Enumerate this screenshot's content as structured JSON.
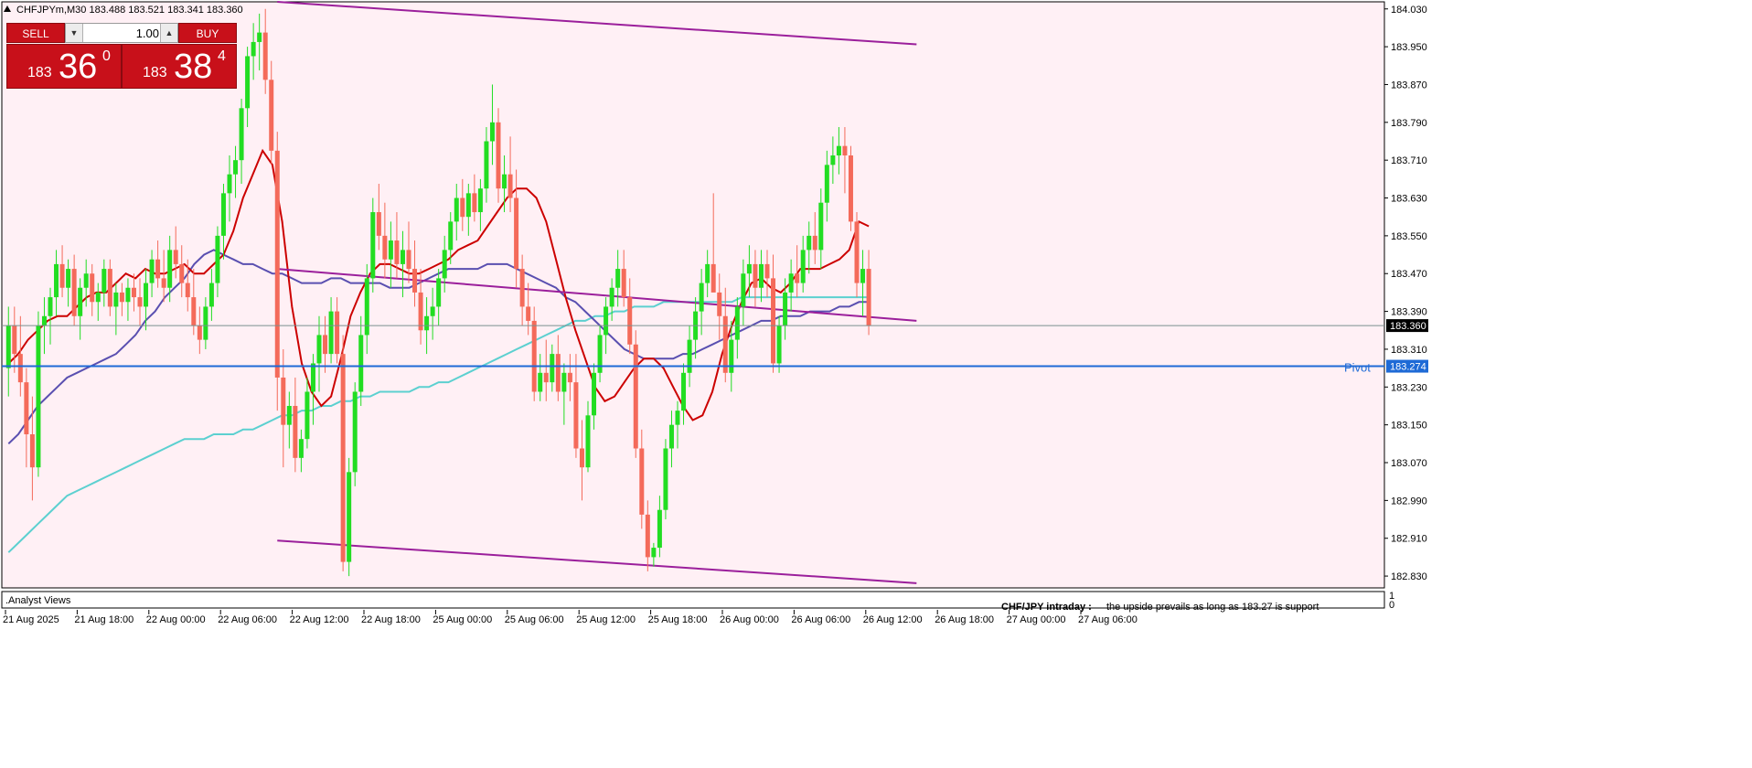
{
  "header": {
    "text": "CHFJPYm,M30  183.488 183.521 183.341 183.360"
  },
  "trade_panel": {
    "sell_label": "SELL",
    "buy_label": "BUY",
    "lot": "1.00",
    "sell_price": {
      "prefix": "183",
      "big": "36",
      "sup": "0"
    },
    "buy_price": {
      "prefix": "183",
      "big": "38",
      "sup": "4"
    }
  },
  "indicator": {
    "label": ".Analyst Views",
    "scale_top": "1",
    "scale_bottom": "0"
  },
  "comment": {
    "label": "CHF/JPY intraday :",
    "text": "the upside prevails as long as 183.27 is support"
  },
  "pivot": {
    "label": "Pivot",
    "value": 183.274,
    "value_label": "183.274",
    "color": "#1e6ad6"
  },
  "current_price": {
    "value": 183.36,
    "label": "183.360"
  },
  "colors": {
    "background": "#fff0f5",
    "bull": "#22dd22",
    "bear": "#f46a5a",
    "ma_fast": "#cc0000",
    "ma_mid": "#5a4fb0",
    "ma_slow": "#5cd0d0",
    "channel": "#9b1f9b"
  },
  "chart_data": {
    "type": "candlestick",
    "symbol": "CHFJPYm",
    "timeframe": "M30",
    "x_labels": [
      "21 Aug 2025",
      "21 Aug 18:00",
      "22 Aug 00:00",
      "22 Aug 06:00",
      "22 Aug 12:00",
      "22 Aug 18:00",
      "25 Aug 00:00",
      "25 Aug 06:00",
      "25 Aug 12:00",
      "25 Aug 18:00",
      "26 Aug 00:00",
      "26 Aug 06:00",
      "26 Aug 12:00",
      "26 Aug 18:00",
      "27 Aug 00:00",
      "27 Aug 06:00"
    ],
    "y_ticks": [
      184.03,
      183.95,
      183.87,
      183.79,
      183.71,
      183.63,
      183.55,
      183.47,
      183.39,
      183.31,
      183.23,
      183.15,
      183.07,
      182.99,
      182.91,
      182.83
    ],
    "ylim": [
      182.805,
      184.045
    ],
    "candles_per_label": 12,
    "candles": [
      [
        183.27,
        183.4,
        183.21,
        183.36
      ],
      [
        183.36,
        183.4,
        183.26,
        183.3
      ],
      [
        183.3,
        183.38,
        183.21,
        183.24
      ],
      [
        183.24,
        183.27,
        183.06,
        183.13
      ],
      [
        183.13,
        183.21,
        182.99,
        183.06
      ],
      [
        183.06,
        183.39,
        183.04,
        183.36
      ],
      [
        183.36,
        183.42,
        183.3,
        183.38
      ],
      [
        183.38,
        183.44,
        183.32,
        183.42
      ],
      [
        183.42,
        183.52,
        183.38,
        183.49
      ],
      [
        183.49,
        183.53,
        183.42,
        183.44
      ],
      [
        183.44,
        183.5,
        183.4,
        183.48
      ],
      [
        183.48,
        183.51,
        183.36,
        183.38
      ],
      [
        183.38,
        183.46,
        183.33,
        183.44
      ],
      [
        183.44,
        183.5,
        183.4,
        183.47
      ],
      [
        183.47,
        183.49,
        183.38,
        183.41
      ],
      [
        183.41,
        183.45,
        183.37,
        183.43
      ],
      [
        183.43,
        183.5,
        183.4,
        183.48
      ],
      [
        183.48,
        183.5,
        183.38,
        183.4
      ],
      [
        183.4,
        183.45,
        183.34,
        183.43
      ],
      [
        183.43,
        183.45,
        183.38,
        183.41
      ],
      [
        183.41,
        183.46,
        183.37,
        183.44
      ],
      [
        183.44,
        183.47,
        183.39,
        183.42
      ],
      [
        183.42,
        183.46,
        183.36,
        183.4
      ],
      [
        183.4,
        183.48,
        183.35,
        183.45
      ],
      [
        183.45,
        183.52,
        183.42,
        183.5
      ],
      [
        183.5,
        183.54,
        183.44,
        183.46
      ],
      [
        183.46,
        183.52,
        183.41,
        183.44
      ],
      [
        183.44,
        183.55,
        183.41,
        183.52
      ],
      [
        183.52,
        183.57,
        183.46,
        183.49
      ],
      [
        183.49,
        183.53,
        183.42,
        183.45
      ],
      [
        183.45,
        183.5,
        183.39,
        183.42
      ],
      [
        183.42,
        183.48,
        183.34,
        183.36
      ],
      [
        183.36,
        183.4,
        183.3,
        183.33
      ],
      [
        183.33,
        183.42,
        183.31,
        183.4
      ],
      [
        183.4,
        183.48,
        183.37,
        183.45
      ],
      [
        183.45,
        183.57,
        183.42,
        183.55
      ],
      [
        183.55,
        183.66,
        183.5,
        183.64
      ],
      [
        183.64,
        183.72,
        183.58,
        183.68
      ],
      [
        183.68,
        183.74,
        183.63,
        183.71
      ],
      [
        183.71,
        183.84,
        183.66,
        183.82
      ],
      [
        183.82,
        183.95,
        183.78,
        183.93
      ],
      [
        183.93,
        184.0,
        183.88,
        183.96
      ],
      [
        183.96,
        184.02,
        183.9,
        183.98
      ],
      [
        183.98,
        184.03,
        183.85,
        183.88
      ],
      [
        183.88,
        183.92,
        183.7,
        183.73
      ],
      [
        183.73,
        183.77,
        183.18,
        183.25
      ],
      [
        183.25,
        183.31,
        183.06,
        183.15
      ],
      [
        183.15,
        183.22,
        183.1,
        183.19
      ],
      [
        183.19,
        183.25,
        183.05,
        183.08
      ],
      [
        183.08,
        183.14,
        183.05,
        183.12
      ],
      [
        183.12,
        183.25,
        183.1,
        183.22
      ],
      [
        183.22,
        183.3,
        183.15,
        183.28
      ],
      [
        183.28,
        183.38,
        183.22,
        183.34
      ],
      [
        183.34,
        183.38,
        183.26,
        183.3
      ],
      [
        183.3,
        183.42,
        183.28,
        183.39
      ],
      [
        183.39,
        183.42,
        183.28,
        183.3
      ],
      [
        183.3,
        183.34,
        182.84,
        182.86
      ],
      [
        182.86,
        183.08,
        182.83,
        183.05
      ],
      [
        183.05,
        183.24,
        183.02,
        183.22
      ],
      [
        183.22,
        183.38,
        183.19,
        183.34
      ],
      [
        183.34,
        183.49,
        183.3,
        183.46
      ],
      [
        183.46,
        183.63,
        183.43,
        183.6
      ],
      [
        183.6,
        183.66,
        183.52,
        183.55
      ],
      [
        183.55,
        183.62,
        183.46,
        183.5
      ],
      [
        183.5,
        183.58,
        183.44,
        183.54
      ],
      [
        183.54,
        183.6,
        183.46,
        183.49
      ],
      [
        183.49,
        183.56,
        183.42,
        183.52
      ],
      [
        183.52,
        183.58,
        183.45,
        183.48
      ],
      [
        183.48,
        183.54,
        183.4,
        183.43
      ],
      [
        183.43,
        183.48,
        183.32,
        183.35
      ],
      [
        183.35,
        183.42,
        183.3,
        183.38
      ],
      [
        183.38,
        183.44,
        183.33,
        183.4
      ],
      [
        183.4,
        183.48,
        183.36,
        183.46
      ],
      [
        183.46,
        183.55,
        183.43,
        183.52
      ],
      [
        183.52,
        183.6,
        183.49,
        183.58
      ],
      [
        183.58,
        183.66,
        183.54,
        183.63
      ],
      [
        183.63,
        183.67,
        183.56,
        183.59
      ],
      [
        183.59,
        183.66,
        183.55,
        183.64
      ],
      [
        183.64,
        183.68,
        183.58,
        183.6
      ],
      [
        183.6,
        183.67,
        183.56,
        183.65
      ],
      [
        183.65,
        183.78,
        183.62,
        183.75
      ],
      [
        183.75,
        183.87,
        183.7,
        183.79
      ],
      [
        183.79,
        183.82,
        183.62,
        183.65
      ],
      [
        183.65,
        183.72,
        183.6,
        183.68
      ],
      [
        183.68,
        183.76,
        183.6,
        183.63
      ],
      [
        183.63,
        183.69,
        183.44,
        183.48
      ],
      [
        183.48,
        183.51,
        183.36,
        183.4
      ],
      [
        183.4,
        183.45,
        183.34,
        183.37
      ],
      [
        183.37,
        183.4,
        183.2,
        183.22
      ],
      [
        183.22,
        183.3,
        183.2,
        183.26
      ],
      [
        183.26,
        183.33,
        183.2,
        183.24
      ],
      [
        183.24,
        183.32,
        183.22,
        183.3
      ],
      [
        183.3,
        183.34,
        183.2,
        183.22
      ],
      [
        183.22,
        183.28,
        183.15,
        183.26
      ],
      [
        183.26,
        183.3,
        183.2,
        183.24
      ],
      [
        183.24,
        183.3,
        183.08,
        183.1
      ],
      [
        183.1,
        183.16,
        182.99,
        183.06
      ],
      [
        183.06,
        183.2,
        183.05,
        183.17
      ],
      [
        183.17,
        183.28,
        183.14,
        183.26
      ],
      [
        183.26,
        183.36,
        183.24,
        183.34
      ],
      [
        183.34,
        183.42,
        183.3,
        183.4
      ],
      [
        183.4,
        183.46,
        183.37,
        183.44
      ],
      [
        183.44,
        183.52,
        183.4,
        183.48
      ],
      [
        183.48,
        183.52,
        183.4,
        183.42
      ],
      [
        183.42,
        183.46,
        183.3,
        183.32
      ],
      [
        183.32,
        183.35,
        183.08,
        183.1
      ],
      [
        183.1,
        183.14,
        182.93,
        182.96
      ],
      [
        182.96,
        182.99,
        182.84,
        182.87
      ],
      [
        182.87,
        182.9,
        182.85,
        182.89
      ],
      [
        182.89,
        183.0,
        182.87,
        182.97
      ],
      [
        182.97,
        183.12,
        182.95,
        183.1
      ],
      [
        183.1,
        183.18,
        183.06,
        183.15
      ],
      [
        183.15,
        183.2,
        183.1,
        183.18
      ],
      [
        183.18,
        183.28,
        183.15,
        183.26
      ],
      [
        183.26,
        183.36,
        183.23,
        183.33
      ],
      [
        183.33,
        183.42,
        183.29,
        183.39
      ],
      [
        183.39,
        183.48,
        183.34,
        183.45
      ],
      [
        183.45,
        183.52,
        183.42,
        183.49
      ],
      [
        183.49,
        183.64,
        183.46,
        183.43
      ],
      [
        183.43,
        183.47,
        183.33,
        183.38
      ],
      [
        183.38,
        183.44,
        183.24,
        183.26
      ],
      [
        183.26,
        183.37,
        183.22,
        183.33
      ],
      [
        183.33,
        183.42,
        183.29,
        183.4
      ],
      [
        183.4,
        183.5,
        183.36,
        183.47
      ],
      [
        183.47,
        183.53,
        183.42,
        183.49
      ],
      [
        183.49,
        183.52,
        183.4,
        183.44
      ],
      [
        183.44,
        183.52,
        183.41,
        183.49
      ],
      [
        183.49,
        183.52,
        183.42,
        183.46
      ],
      [
        183.46,
        183.51,
        183.26,
        183.28
      ],
      [
        183.28,
        183.38,
        183.26,
        183.36
      ],
      [
        183.36,
        183.46,
        183.33,
        183.43
      ],
      [
        183.43,
        183.5,
        183.39,
        183.47
      ],
      [
        183.47,
        183.53,
        183.42,
        183.45
      ],
      [
        183.45,
        183.55,
        183.43,
        183.52
      ],
      [
        183.52,
        183.58,
        183.47,
        183.55
      ],
      [
        183.55,
        183.6,
        183.49,
        183.52
      ],
      [
        183.52,
        183.65,
        183.48,
        183.62
      ],
      [
        183.62,
        183.73,
        183.58,
        183.7
      ],
      [
        183.7,
        183.76,
        183.66,
        183.72
      ],
      [
        183.72,
        183.78,
        183.68,
        183.74
      ],
      [
        183.74,
        183.78,
        183.64,
        183.72
      ],
      [
        183.72,
        183.74,
        183.56,
        183.58
      ],
      [
        183.58,
        183.6,
        183.42,
        183.45
      ],
      [
        183.45,
        183.52,
        183.38,
        183.48
      ],
      [
        183.48,
        183.52,
        183.34,
        183.36
      ]
    ],
    "moving_averages": [
      {
        "name": "ma_fast",
        "values": [
          183.28,
          183.3,
          183.33,
          183.35,
          183.37,
          183.38,
          183.38,
          183.4,
          183.42,
          183.43,
          183.43,
          183.45,
          183.47,
          183.46,
          183.48,
          183.47,
          183.47,
          183.48,
          183.49,
          183.47,
          183.47,
          183.49,
          183.51,
          183.56,
          183.63,
          183.68,
          183.73,
          183.7,
          183.58,
          183.4,
          183.28,
          183.22,
          183.19,
          183.21,
          183.29,
          183.38,
          183.43,
          183.47,
          183.49,
          183.49,
          183.48,
          183.47,
          183.47,
          183.48,
          183.49,
          183.5,
          183.52,
          183.53,
          183.54,
          183.57,
          183.6,
          183.63,
          183.65,
          183.65,
          183.63,
          183.58,
          183.5,
          183.42,
          183.35,
          183.29,
          183.23,
          183.2,
          183.21,
          183.24,
          183.27,
          183.29,
          183.29,
          183.27,
          183.23,
          183.19,
          183.16,
          183.17,
          183.22,
          183.3,
          183.36,
          183.41,
          183.45,
          183.46,
          183.44,
          183.43,
          183.45,
          183.48,
          183.48,
          183.48,
          183.49,
          183.5,
          183.52,
          183.58,
          183.57
        ]
      },
      {
        "name": "ma_mid",
        "values": [
          183.11,
          183.13,
          183.16,
          183.19,
          183.21,
          183.23,
          183.25,
          183.26,
          183.27,
          183.28,
          183.29,
          183.3,
          183.32,
          183.34,
          183.37,
          183.39,
          183.42,
          183.44,
          183.46,
          183.49,
          183.51,
          183.52,
          183.51,
          183.5,
          183.49,
          183.49,
          183.48,
          183.47,
          183.47,
          183.46,
          183.45,
          183.45,
          183.45,
          183.46,
          183.46,
          183.45,
          183.45,
          183.45,
          183.45,
          183.44,
          183.44,
          183.44,
          183.45,
          183.46,
          183.47,
          183.48,
          183.48,
          183.48,
          183.48,
          183.49,
          183.49,
          183.49,
          183.48,
          183.47,
          183.46,
          183.45,
          183.44,
          183.42,
          183.41,
          183.39,
          183.37,
          183.35,
          183.33,
          183.31,
          183.3,
          183.29,
          183.29,
          183.29,
          183.29,
          183.3,
          183.3,
          183.31,
          183.32,
          183.33,
          183.34,
          183.35,
          183.36,
          183.37,
          183.37,
          183.38,
          183.38,
          183.38,
          183.39,
          183.39,
          183.39,
          183.4,
          183.4,
          183.41,
          183.41
        ]
      },
      {
        "name": "ma_slow",
        "values": [
          182.88,
          182.9,
          182.92,
          182.94,
          182.96,
          182.98,
          183.0,
          183.01,
          183.02,
          183.03,
          183.04,
          183.05,
          183.06,
          183.07,
          183.08,
          183.09,
          183.1,
          183.11,
          183.12,
          183.12,
          183.12,
          183.13,
          183.13,
          183.13,
          183.14,
          183.14,
          183.15,
          183.16,
          183.17,
          183.17,
          183.18,
          183.18,
          183.19,
          183.19,
          183.2,
          183.2,
          183.21,
          183.21,
          183.22,
          183.22,
          183.22,
          183.22,
          183.23,
          183.23,
          183.24,
          183.24,
          183.25,
          183.26,
          183.27,
          183.28,
          183.29,
          183.3,
          183.31,
          183.32,
          183.33,
          183.34,
          183.35,
          183.36,
          183.37,
          183.37,
          183.38,
          183.38,
          183.39,
          183.39,
          183.4,
          183.4,
          183.4,
          183.41,
          183.41,
          183.41,
          183.41,
          183.41,
          183.41,
          183.41,
          183.41,
          183.42,
          183.42,
          183.42,
          183.42,
          183.42,
          183.42,
          183.42,
          183.42,
          183.42,
          183.42,
          183.42,
          183.42,
          183.42,
          183.42
        ]
      }
    ],
    "channel_lines": [
      {
        "name": "upper",
        "x0": 45,
        "y0": 184.045,
        "x1": 152,
        "y1": 183.955
      },
      {
        "name": "middle",
        "x0": 45,
        "y0": 183.48,
        "x1": 152,
        "y1": 183.37
      },
      {
        "name": "lower",
        "x0": 45,
        "y0": 182.905,
        "x1": 152,
        "y1": 182.815
      }
    ]
  }
}
